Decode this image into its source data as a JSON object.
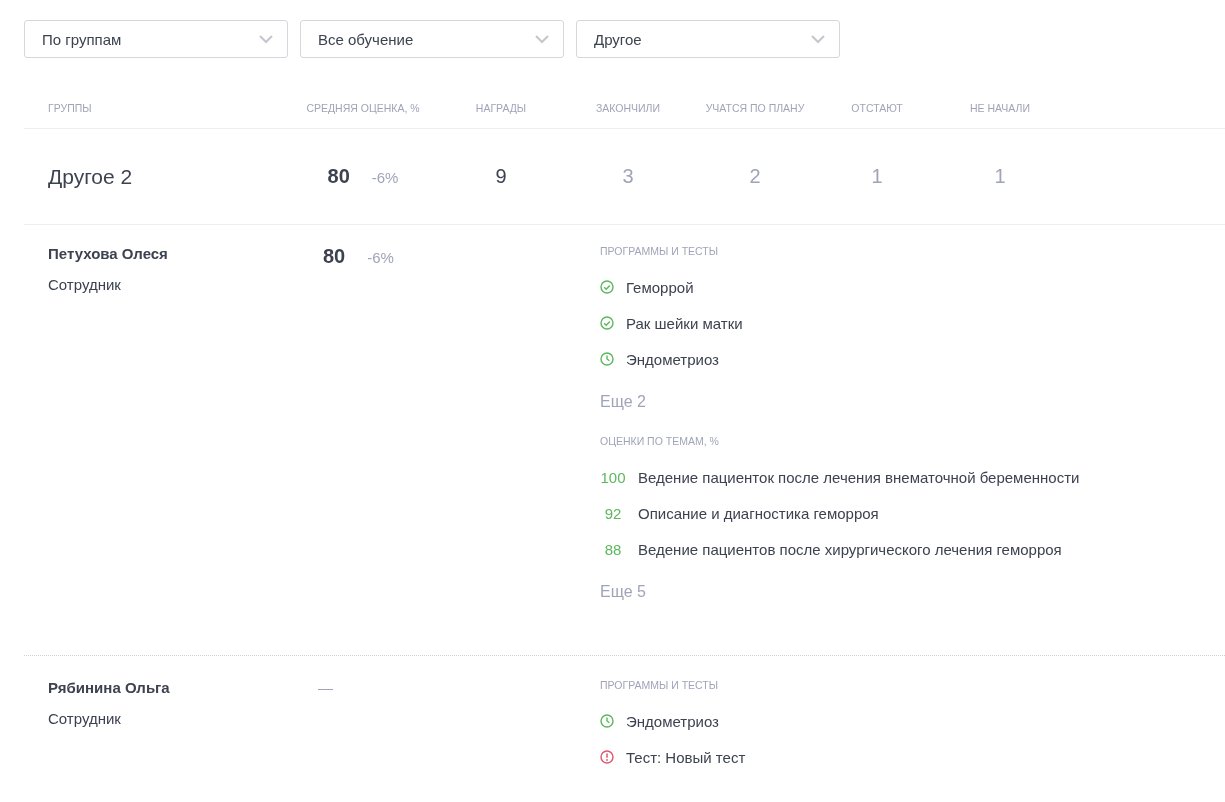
{
  "filters": [
    {
      "value": "По группам"
    },
    {
      "value": "Все обучение"
    },
    {
      "value": "Другое"
    }
  ],
  "table": {
    "columns": [
      "ГРУППЫ",
      "СРЕДНЯЯ ОЦЕНКА, %",
      "НАГРАДЫ",
      "ЗАКОНЧИЛИ",
      "УЧАТСЯ ПО ПЛАНУ",
      "ОТСТАЮТ",
      "НЕ НАЧАЛИ"
    ],
    "group": {
      "name": "Другое 2",
      "score": "80",
      "delta": "-6%",
      "awards": "9",
      "finished": "3",
      "on_plan": "2",
      "behind": "1",
      "not_started": "1"
    },
    "employees": [
      {
        "name": "Петухова Олеся",
        "role": "Сотрудник",
        "score": "80",
        "delta": "-6%",
        "programs_label": "ПРОГРАММЫ И ТЕСТЫ",
        "programs": [
          {
            "kind": "done",
            "title": "Геморрой"
          },
          {
            "kind": "done",
            "title": "Рак шейки матки"
          },
          {
            "kind": "in_progress",
            "title": "Эндометриоз"
          }
        ],
        "programs_more": "Еще 2",
        "topics_label": "ОЦЕНКИ ПО ТЕМАМ, %",
        "topics": [
          {
            "score": "100",
            "title": "Ведение пациенток после лечения внематочной беременности"
          },
          {
            "score": "92",
            "title": "Описание и диагностика геморроя"
          },
          {
            "score": "88",
            "title": "Ведение пациентов после хирургического лечения геморроя"
          }
        ],
        "topics_more": "Еще 5"
      },
      {
        "name": "Рябинина Ольга",
        "role": "Сотрудник",
        "score": "—",
        "programs_label": "ПРОГРАММЫ И ТЕСТЫ",
        "programs": [
          {
            "kind": "in_progress",
            "title": "Эндометриоз"
          },
          {
            "kind": "failed",
            "title": "Тест: Новый тест"
          }
        ]
      }
    ]
  }
}
